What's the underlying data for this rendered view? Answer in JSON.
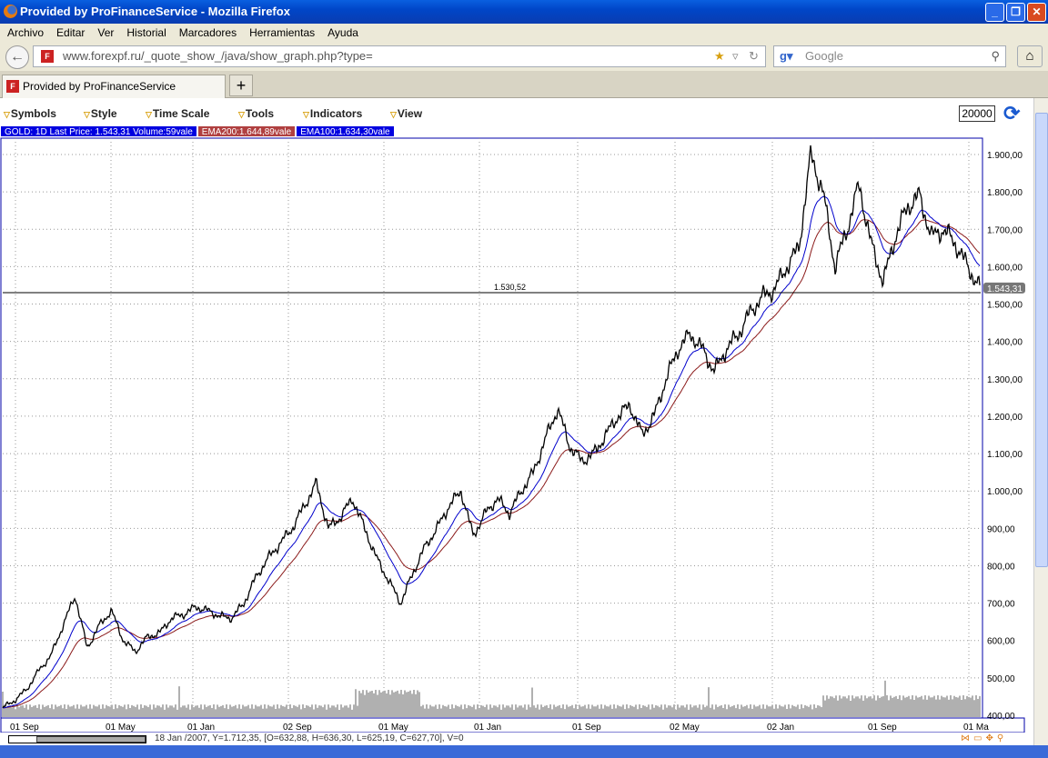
{
  "window": {
    "title": "Provided by ProFinanceService - Mozilla Firefox",
    "min": "_",
    "max": "❐",
    "close": "✕"
  },
  "menu": [
    "Archivo",
    "Editar",
    "Ver",
    "Historial",
    "Marcadores",
    "Herramientas",
    "Ayuda"
  ],
  "nav": {
    "url": "www.forexpf.ru/_quote_show_/java/show_graph.php?type=",
    "search_placeholder": "Google",
    "favicon": "F"
  },
  "tab": {
    "label": "Provided by ProFinanceService",
    "new": "+"
  },
  "toolbar": {
    "items": [
      "Symbols",
      "Style",
      "Time Scale",
      "Tools",
      "Indicators",
      "View"
    ],
    "zoom_value": "20000"
  },
  "legend": {
    "main": "GOLD: 1D Last Price: 1.543,31 Volume:59vale",
    "ema200": "EMA200:1.644,89vale",
    "ema100": "EMA100:1.634,30vale"
  },
  "status": {
    "text": "18 Jan /2007, Y=1.712,35, [O=632,88, H=636,30, L=625,19, C=627,70], V=0",
    "icons": "⋈▭✥⚲"
  },
  "colors": {
    "price": "#000000",
    "ema100": "#0000cc",
    "ema200": "#8b1a1a",
    "volume": "#b0b0b0",
    "accent": "#0000e0"
  },
  "chart_data": {
    "type": "line",
    "title": "GOLD 1D",
    "ylim": [
      390,
      1930
    ],
    "yticks": [
      "400,00",
      "500,00",
      "600,00",
      "700,00",
      "800,00",
      "900,00",
      "1.000,00",
      "1.100,00",
      "1.200,00",
      "1.300,00",
      "1.400,00",
      "1.500,00",
      "1.600,00",
      "1.700,00",
      "1.800,00",
      "1.900,00"
    ],
    "xticks": [
      "01 Sep",
      "01 May",
      "01 Jan",
      "02 Sep",
      "01 May",
      "01 Jan",
      "01 Sep",
      "02 May",
      "02 Jan",
      "01 Sep",
      "01 Ma"
    ],
    "hline": {
      "value": 1530.52,
      "label": "1.530,52"
    },
    "last_label": "1.543,31",
    "series": [
      {
        "name": "GOLD close",
        "values": [
          420,
          440,
          470,
          520,
          560,
          640,
          720,
          580,
          640,
          680,
          600,
          570,
          610,
          620,
          660,
          670,
          690,
          680,
          665,
          660,
          700,
          770,
          820,
          860,
          900,
          960,
          1020,
          900,
          930,
          980,
          900,
          820,
          760,
          700,
          780,
          850,
          900,
          960,
          1000,
          880,
          940,
          980,
          940,
          1000,
          1050,
          1140,
          1220,
          1120,
          1080,
          1100,
          1150,
          1200,
          1230,
          1150,
          1200,
          1300,
          1380,
          1420,
          1380,
          1320,
          1380,
          1420,
          1480,
          1520,
          1540,
          1600,
          1650,
          1900,
          1800,
          1600,
          1700,
          1820,
          1660,
          1560,
          1680,
          1760,
          1790,
          1680,
          1700,
          1660,
          1600,
          1543
        ]
      }
    ]
  }
}
